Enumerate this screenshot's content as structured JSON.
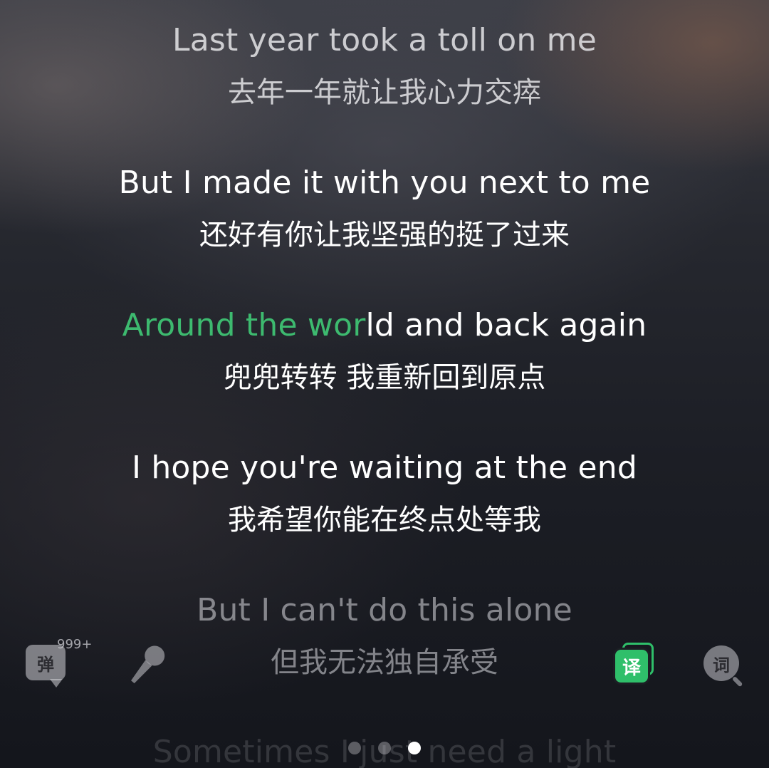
{
  "lyrics": {
    "lines": [
      {
        "en": "Last year took a toll on me",
        "zh": "去年一年就让我心力交瘁"
      },
      {
        "en": "But I made it with you next to me",
        "zh": "还好有你让我坚强的挺了过来"
      },
      {
        "en_sung": "Around the wor",
        "en_unsung": "ld and back again",
        "zh": "兜兜转转 我重新回到原点"
      },
      {
        "en": "I hope you're waiting at the end",
        "zh": "我希望你能在终点处等我"
      },
      {
        "en": "But I can't do this alone",
        "zh": "但我无法独自承受"
      },
      {
        "en": "Sometimes I just need a light"
      }
    ]
  },
  "controls": {
    "danmu": {
      "label": "弹",
      "count": "999+",
      "icon": "danmu-bubble-icon"
    },
    "karaoke": {
      "icon": "microphone-icon"
    },
    "translate": {
      "label": "译",
      "icon": "translate-icon",
      "active_color": "#2fbf6a"
    },
    "lyrics_search": {
      "label": "词",
      "icon": "lyrics-search-icon"
    }
  },
  "pager": {
    "count": 3,
    "active_index": 2
  },
  "colors": {
    "highlight": "#3dba6f",
    "text": "#ffffff"
  }
}
